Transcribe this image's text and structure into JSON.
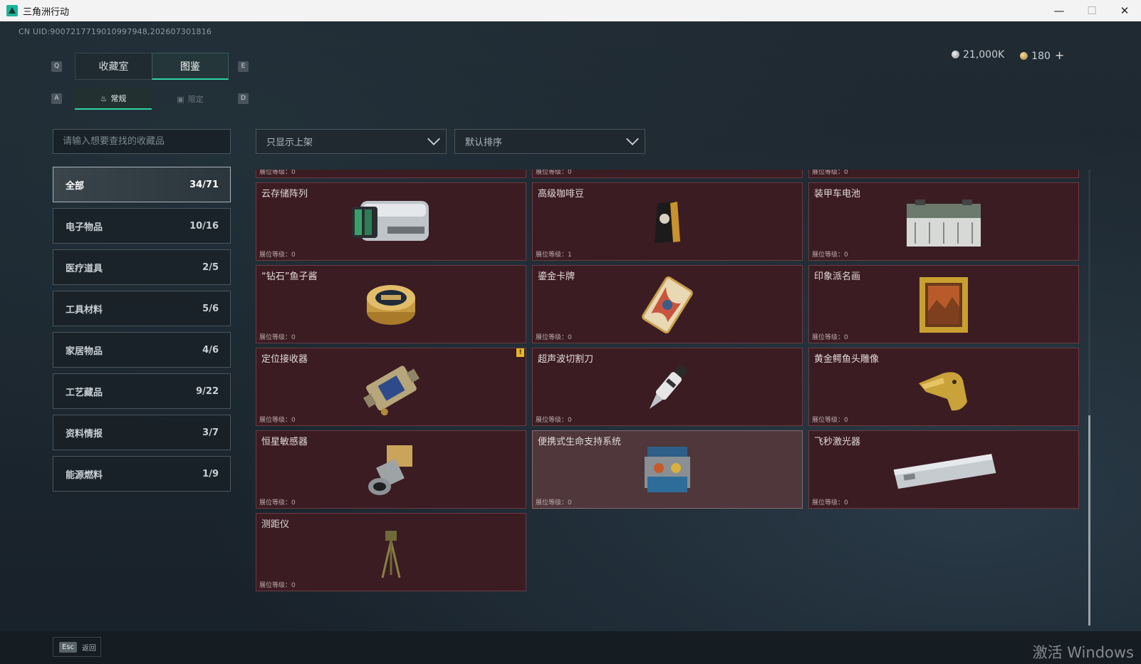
{
  "window": {
    "title": "三角洲行动",
    "minimize": "—",
    "maximize": "☐",
    "close": "✕"
  },
  "uid": "CN UID:9007217719010997948,202607301816",
  "currency": {
    "silver": "21,000K",
    "gold": "180",
    "add": "+"
  },
  "keys": {
    "q": "Q",
    "e": "E",
    "a": "A",
    "d": "D"
  },
  "tabs": [
    {
      "label": "收藏室"
    },
    {
      "label": "图鉴"
    }
  ],
  "subtabs": [
    {
      "label": "常规",
      "icon": "♨"
    },
    {
      "label": "限定",
      "icon": "▣"
    }
  ],
  "search": {
    "placeholder": "请输入想要查找的收藏品"
  },
  "filters": {
    "display": "只显示上架",
    "sort": "默认排序"
  },
  "categories": [
    {
      "name": "全部",
      "count": "34/71"
    },
    {
      "name": "电子物品",
      "count": "10/16"
    },
    {
      "name": "医疗道具",
      "count": "2/5"
    },
    {
      "name": "工具材料",
      "count": "5/6"
    },
    {
      "name": "家居物品",
      "count": "4/6"
    },
    {
      "name": "工艺藏品",
      "count": "9/22"
    },
    {
      "name": "资料情报",
      "count": "3/7"
    },
    {
      "name": "能源燃料",
      "count": "1/9"
    }
  ],
  "level_prefix": "展位等级：",
  "items": [
    {
      "name": "",
      "level": "0"
    },
    {
      "name": "",
      "level": "0"
    },
    {
      "name": "",
      "level": "0"
    },
    {
      "name": "云存储阵列",
      "level": "0",
      "icon": "storage-array-icon"
    },
    {
      "name": "高级咖啡豆",
      "level": "1",
      "icon": "coffee-bag-icon"
    },
    {
      "name": "装甲车电池",
      "level": "0",
      "icon": "battery-icon"
    },
    {
      "name": "“钻石”鱼子酱",
      "level": "0",
      "icon": "caviar-tin-icon"
    },
    {
      "name": "鎏金卡牌",
      "level": "0",
      "icon": "gold-card-icon"
    },
    {
      "name": "印象派名画",
      "level": "0",
      "icon": "painting-icon"
    },
    {
      "name": "定位接收器",
      "level": "0",
      "icon": "receiver-icon",
      "warn": "!"
    },
    {
      "name": "超声波切割刀",
      "level": "0",
      "icon": "ultrasonic-knife-icon"
    },
    {
      "name": "黄金鳄鱼头雕像",
      "level": "0",
      "icon": "croc-statue-icon"
    },
    {
      "name": "恒星敏感器",
      "level": "0",
      "icon": "star-sensor-icon"
    },
    {
      "name": "便携式生命支持系统",
      "level": "0",
      "icon": "life-support-icon"
    },
    {
      "name": "飞秒激光器",
      "level": "0",
      "icon": "laser-icon"
    },
    {
      "name": "测距仪",
      "level": "0",
      "icon": "rangefinder-icon"
    }
  ],
  "footer": {
    "esc_key": "Esc",
    "esc_label": "返回"
  },
  "watermark": "激活 Windows"
}
